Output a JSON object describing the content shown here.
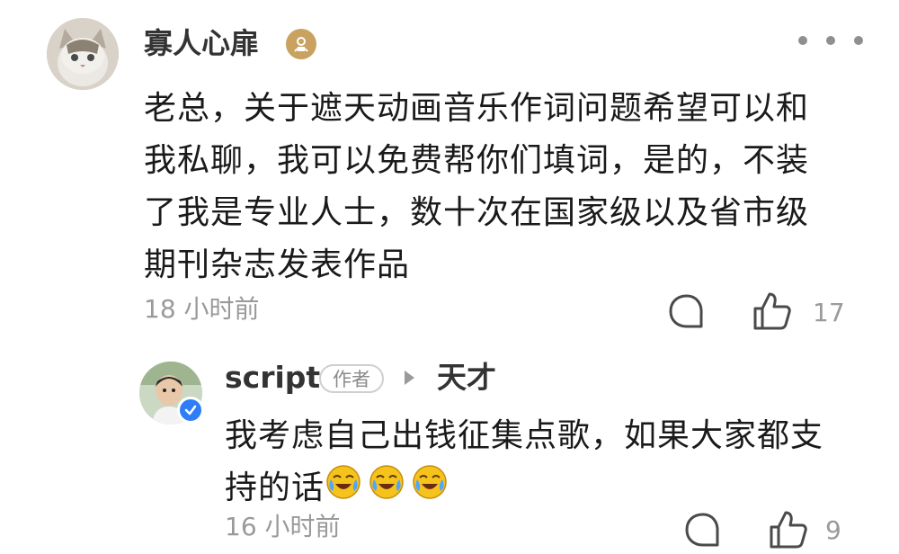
{
  "comment": {
    "username": "寡人心扉",
    "badge_icon": "user-badge-icon",
    "more_icon": "more-dots-icon",
    "text": "老总，关于遮天动画音乐作词问题希望可以和我私聊，我可以免费帮你们填词，是的，不装了我是专业人士，数十次在国家级以及省市级期刊杂志发表作品",
    "time": "18 小时前",
    "reply_icon": "comment-bubble-icon",
    "like_icon": "thumbs-up-icon",
    "like_count": "17"
  },
  "reply": {
    "username": "script",
    "author_tag": "作者",
    "verified_icon": "verified-check-icon",
    "arrow_icon": "reply-arrow-icon",
    "reply_to": "天才",
    "text": "我考虑自己出钱征集点歌，如果大家都支持的话",
    "emojis": [
      "laughing-crying-emoji",
      "laughing-crying-emoji",
      "laughing-crying-emoji"
    ],
    "time": "16 小时前",
    "reply_icon": "comment-bubble-icon",
    "like_icon": "thumbs-up-icon",
    "like_count": "9"
  },
  "colors": {
    "text": "#1a1a1a",
    "secondary": "#9a9a9a",
    "verified": "#2f7df6",
    "badge": "#c9a25f",
    "emoji": "#f6c21c"
  }
}
